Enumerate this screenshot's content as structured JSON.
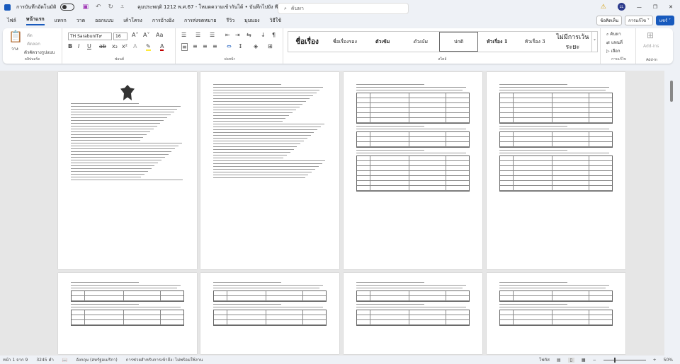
{
  "titlebar": {
    "autosave": "การบันทึกอัตโนมัติ",
    "doc_title": "คุมประพฤติ 1212 พ.ศ.67 - โหมดความเข้ากันได้ • บันทึกไปยัง พีซีนี้ ˅",
    "search_placeholder": "ค้นหา",
    "avatar": "LL",
    "minimize": "—",
    "restore": "❐",
    "close": "✕"
  },
  "tabs": [
    "ไฟล์",
    "หน้าแรก",
    "แทรก",
    "วาด",
    "ออกแบบ",
    "เค้าโครง",
    "การอ้างอิง",
    "การส่งจดหมาย",
    "รีวิว",
    "มุมมอง",
    "วิธีใช้"
  ],
  "tab_buttons": {
    "comments": "ข้อคิดเห็น",
    "editing": "การแก้ไข ˅",
    "share": "แชร์ ˅"
  },
  "clipboard": {
    "paste": "วาง",
    "cut": "ตัด",
    "copy": "คัดลอก",
    "format_painter": "ตัวคัดวางรูปแบบ",
    "label": "คลิปบอร์ด"
  },
  "font": {
    "name": "TH SarabunIT๙",
    "size": "16",
    "label": "ฟอนต์"
  },
  "paragraph": {
    "label": "ย่อหน้า"
  },
  "styles": {
    "items": [
      "ชื่อเรื่อง",
      "ชื่อเรื่องรอง",
      "ตัวเข้ม",
      "ตัวเน้น",
      "ปกติ",
      "หัวเรื่อง 1",
      "หัวเรื่อง 3",
      "ไม่มีการเว้นระยะ"
    ],
    "selected": "ปกติ",
    "label": "สไตล์"
  },
  "editing": {
    "find": "ค้นหา",
    "replace": "แทนที่",
    "select": "เลือก",
    "label": "การแก้ไข"
  },
  "addins": {
    "button": "Add-ins",
    "label": "Add-in"
  },
  "status": {
    "page": "หน้า 1 จาก 9",
    "words": "3245 คำ",
    "language": "อังกฤษ (สหรัฐอเมริกา)",
    "accessibility": "การช่วยสำหรับการเข้าถึง: ไม่พร้อมใช้งาน",
    "focus": "โฟกัส",
    "zoom": "50%"
  },
  "colors": {
    "accent": "#185abd",
    "highlight": "#ffeb3b",
    "font_color": "#c00000"
  }
}
